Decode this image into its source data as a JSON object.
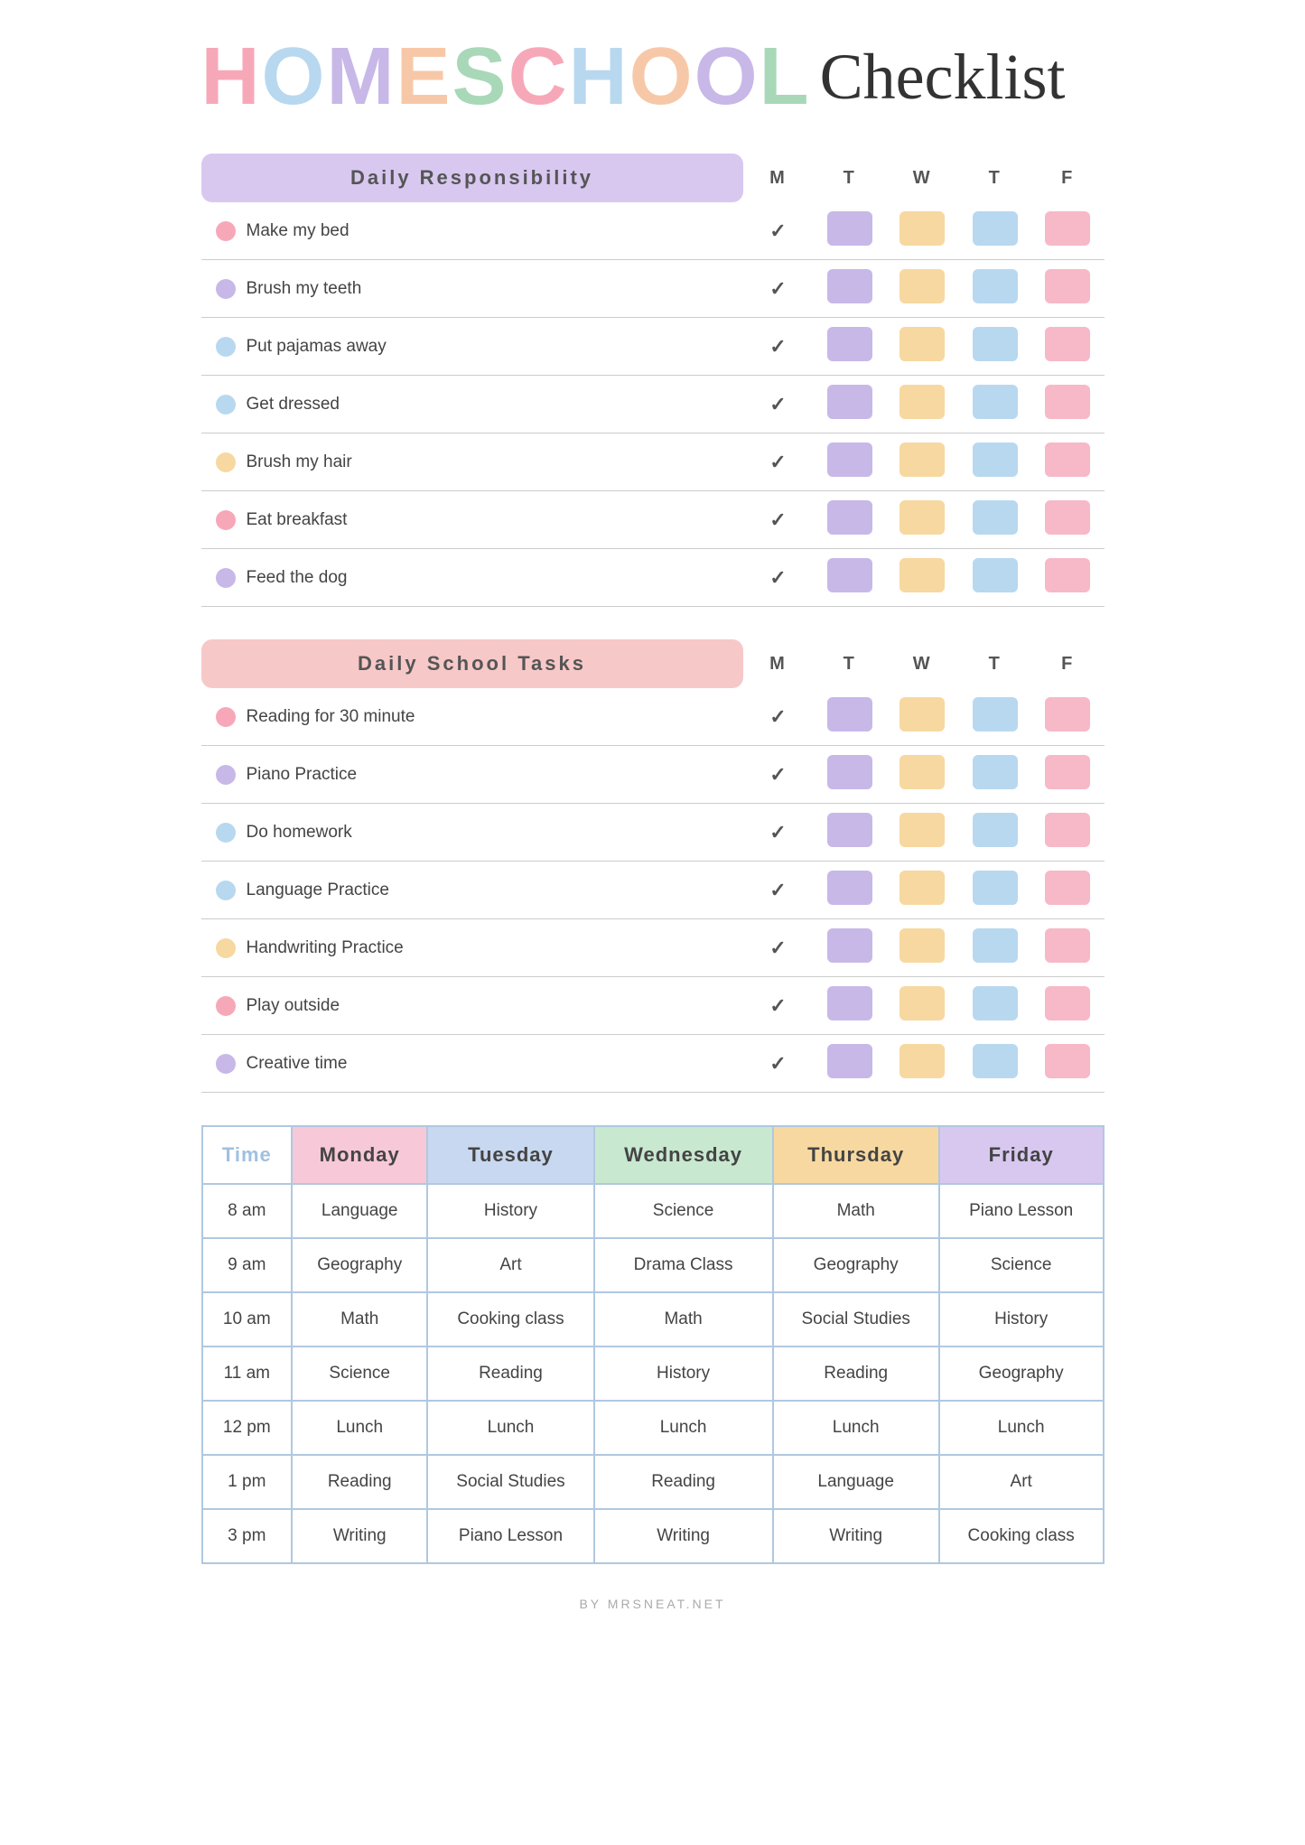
{
  "title": {
    "homeschool_letters": [
      "H",
      "O",
      "M",
      "E",
      "S",
      "C",
      "H",
      "O",
      "O",
      "L"
    ],
    "checklist": "Checklist"
  },
  "daily_responsibility": {
    "section_label": "Daily Responsibility",
    "days": [
      "M",
      "T",
      "W",
      "T",
      "F"
    ],
    "items": [
      {
        "label": "Make my bed",
        "dot_color": "#f7a8b8",
        "checked": true
      },
      {
        "label": "Brush my teeth",
        "dot_color": "#c8b8e8",
        "checked": true
      },
      {
        "label": "Put pajamas away",
        "dot_color": "#b8d8f0",
        "checked": true
      },
      {
        "label": "Get dressed",
        "dot_color": "#b8d8f0",
        "checked": true
      },
      {
        "label": "Brush my hair",
        "dot_color": "#f7d8a0",
        "checked": true
      },
      {
        "label": "Eat breakfast",
        "dot_color": "#f7a8b8",
        "checked": true
      },
      {
        "label": "Feed the dog",
        "dot_color": "#c8b8e8",
        "checked": true
      }
    ]
  },
  "daily_school_tasks": {
    "section_label": "Daily School Tasks",
    "days": [
      "M",
      "T",
      "W",
      "T",
      "F"
    ],
    "items": [
      {
        "label": "Reading for 30 minute",
        "dot_color": "#f7a8b8",
        "checked": true
      },
      {
        "label": "Piano Practice",
        "dot_color": "#c8b8e8",
        "checked": true
      },
      {
        "label": "Do homework",
        "dot_color": "#b8d8f0",
        "checked": true
      },
      {
        "label": "Language Practice",
        "dot_color": "#b8d8f0",
        "checked": true
      },
      {
        "label": "Handwriting Practice",
        "dot_color": "#f7d8a0",
        "checked": true
      },
      {
        "label": "Play outside",
        "dot_color": "#f7a8b8",
        "checked": true
      },
      {
        "label": "Creative time",
        "dot_color": "#c8b8e8",
        "checked": true
      }
    ]
  },
  "schedule": {
    "headers": [
      "Time",
      "Monday",
      "Tuesday",
      "Wednesday",
      "Thursday",
      "Friday"
    ],
    "rows": [
      {
        "time": "8 am",
        "mon": "Language",
        "tue": "History",
        "wed": "Science",
        "thu": "Math",
        "fri": "Piano Lesson"
      },
      {
        "time": "9 am",
        "mon": "Geography",
        "tue": "Art",
        "wed": "Drama Class",
        "thu": "Geography",
        "fri": "Science"
      },
      {
        "time": "10 am",
        "mon": "Math",
        "tue": "Cooking class",
        "wed": "Math",
        "thu": "Social Studies",
        "fri": "History"
      },
      {
        "time": "11 am",
        "mon": "Science",
        "tue": "Reading",
        "wed": "History",
        "thu": "Reading",
        "fri": "Geography"
      },
      {
        "time": "12 pm",
        "mon": "Lunch",
        "tue": "Lunch",
        "wed": "Lunch",
        "thu": "Lunch",
        "fri": "Lunch"
      },
      {
        "time": "1 pm",
        "mon": "Reading",
        "tue": "Social Studies",
        "wed": "Reading",
        "thu": "Language",
        "fri": "Art"
      },
      {
        "time": "3 pm",
        "mon": "Writing",
        "tue": "Piano Lesson",
        "wed": "Writing",
        "thu": "Writing",
        "fri": "Cooking class"
      }
    ]
  },
  "footer": "BY MRSNEAT.NET"
}
